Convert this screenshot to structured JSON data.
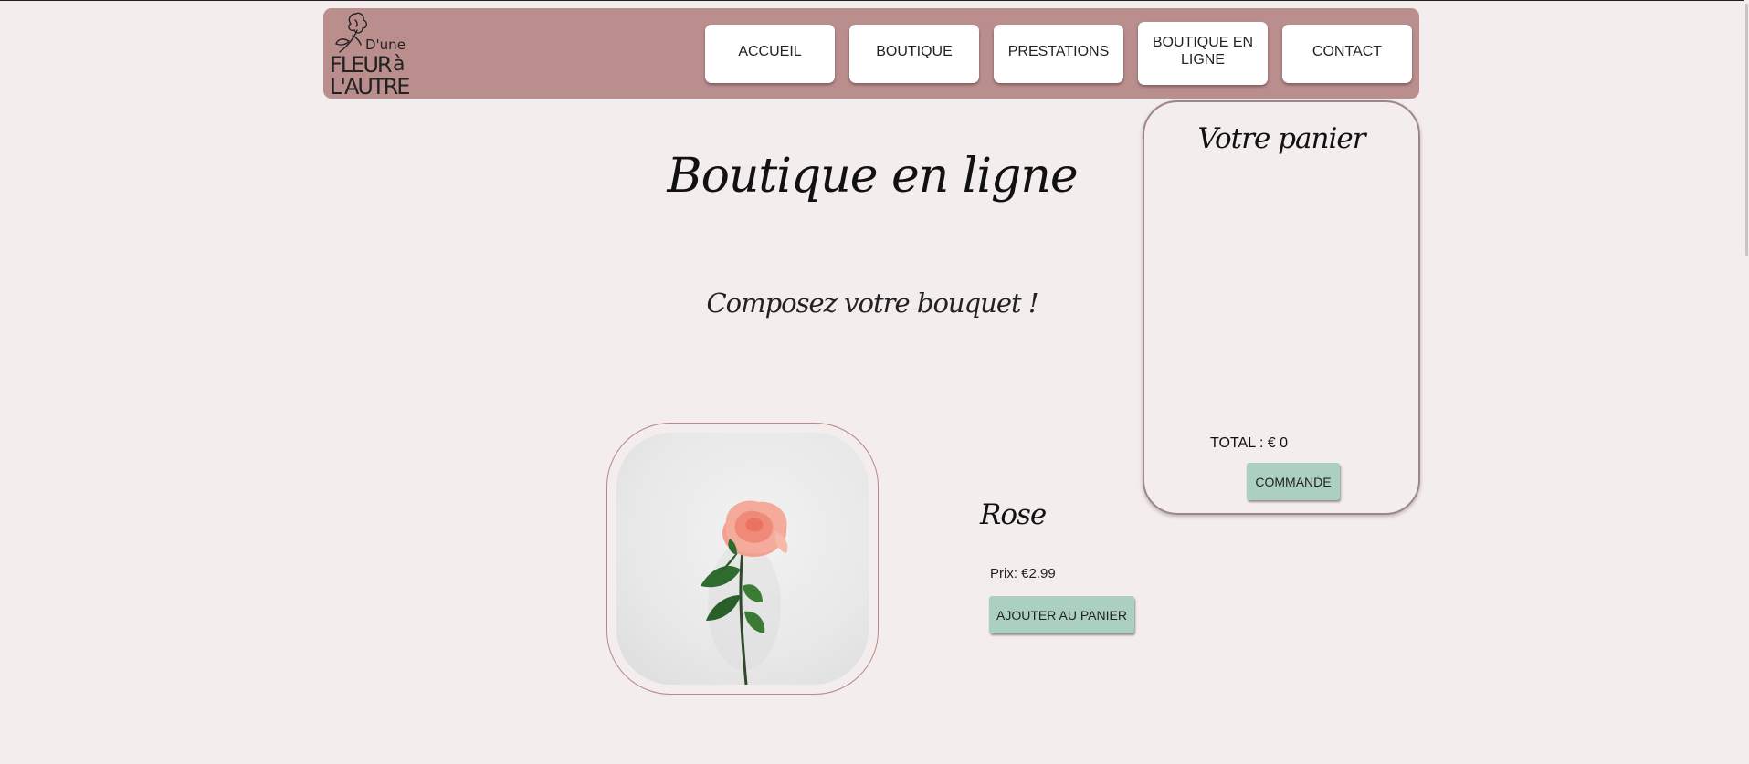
{
  "logo": {
    "line1": "D'une",
    "line2": "FLEUR",
    "line3": "à",
    "line4": "L'AUTRE",
    "icon": "flower-logo-icon"
  },
  "nav": [
    {
      "label": "ACCUEIL",
      "active": false
    },
    {
      "label": "BOUTIQUE",
      "active": false
    },
    {
      "label": "PRESTATIONS",
      "active": false
    },
    {
      "label": "BOUTIQUE EN LIGNE",
      "active": true
    },
    {
      "label": "CONTACT",
      "active": false
    }
  ],
  "page": {
    "title": "Boutique en ligne",
    "subtitle": "Composez votre bouquet !"
  },
  "product": {
    "name": "Rose",
    "price_label": "Prix:",
    "price": "€2.99",
    "add_button": "AJOUTER AU PANIER",
    "image": "pink-rose-photo"
  },
  "cart": {
    "title": "Votre panier",
    "total": "TOTAL : € 0",
    "order_button": "COMMANDE"
  },
  "colors": {
    "background": "#f4eded",
    "header": "#bb8e8e",
    "button_green": "#acd0c0",
    "frame_border": "#b98787"
  }
}
